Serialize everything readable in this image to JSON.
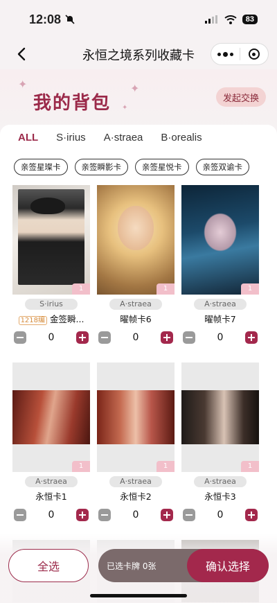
{
  "status": {
    "time": "12:08",
    "battery": "83"
  },
  "nav": {
    "title": "永恒之境系列收藏卡"
  },
  "header": {
    "title": "我的背包",
    "exchange_label": "发起交换"
  },
  "tabs": [
    {
      "label": "ALL",
      "active": true
    },
    {
      "label": "S·irius"
    },
    {
      "label": "A·straea"
    },
    {
      "label": "B·orealis"
    }
  ],
  "chips": [
    "亲签星璨卡",
    "亲签瞬影卡",
    "亲签星悦卡",
    "亲签双谕卡"
  ],
  "cards": [
    {
      "series": "S·irius",
      "name": "金签瞬...",
      "num_tag": "1218编",
      "badge": "1",
      "qty": "0"
    },
    {
      "series": "A·straea",
      "name": "曜帧卡6",
      "badge": "1",
      "qty": "0"
    },
    {
      "series": "A·straea",
      "name": "曜帧卡7",
      "badge": "1",
      "qty": "0"
    },
    {
      "series": "A·straea",
      "name": "永恒卡1",
      "badge": "1",
      "qty": "0"
    },
    {
      "series": "A·straea",
      "name": "永恒卡2",
      "badge": "1",
      "qty": "0"
    },
    {
      "series": "A·straea",
      "name": "永恒卡3",
      "badge": "1",
      "qty": "0"
    }
  ],
  "bottom": {
    "select_all": "全选",
    "selected_text": "已选卡牌 0张",
    "confirm": "确认选择"
  },
  "colors": {
    "accent": "#a3284c",
    "title": "#9b2a4a"
  }
}
